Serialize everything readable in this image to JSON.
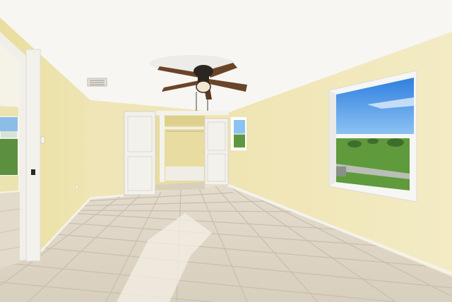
{
  "scene": {
    "colors": {
      "ceiling": "#f7f6f2",
      "wall_back": "#efe5b6",
      "wall_left": "#ece2ad",
      "wall_right": "#f0e6b7",
      "floor": "#ddd4c4",
      "grout": "#c9bfae",
      "trim": "#f4f2ec",
      "door": "#f3f1ec",
      "closet_interior": "#e8dca0",
      "sky": "#3d8fe6",
      "grass": "#5f9a3d",
      "fan_blade": "#6b4428",
      "fan_body": "#2c2622",
      "light_glass": "#f3e7cf"
    }
  }
}
